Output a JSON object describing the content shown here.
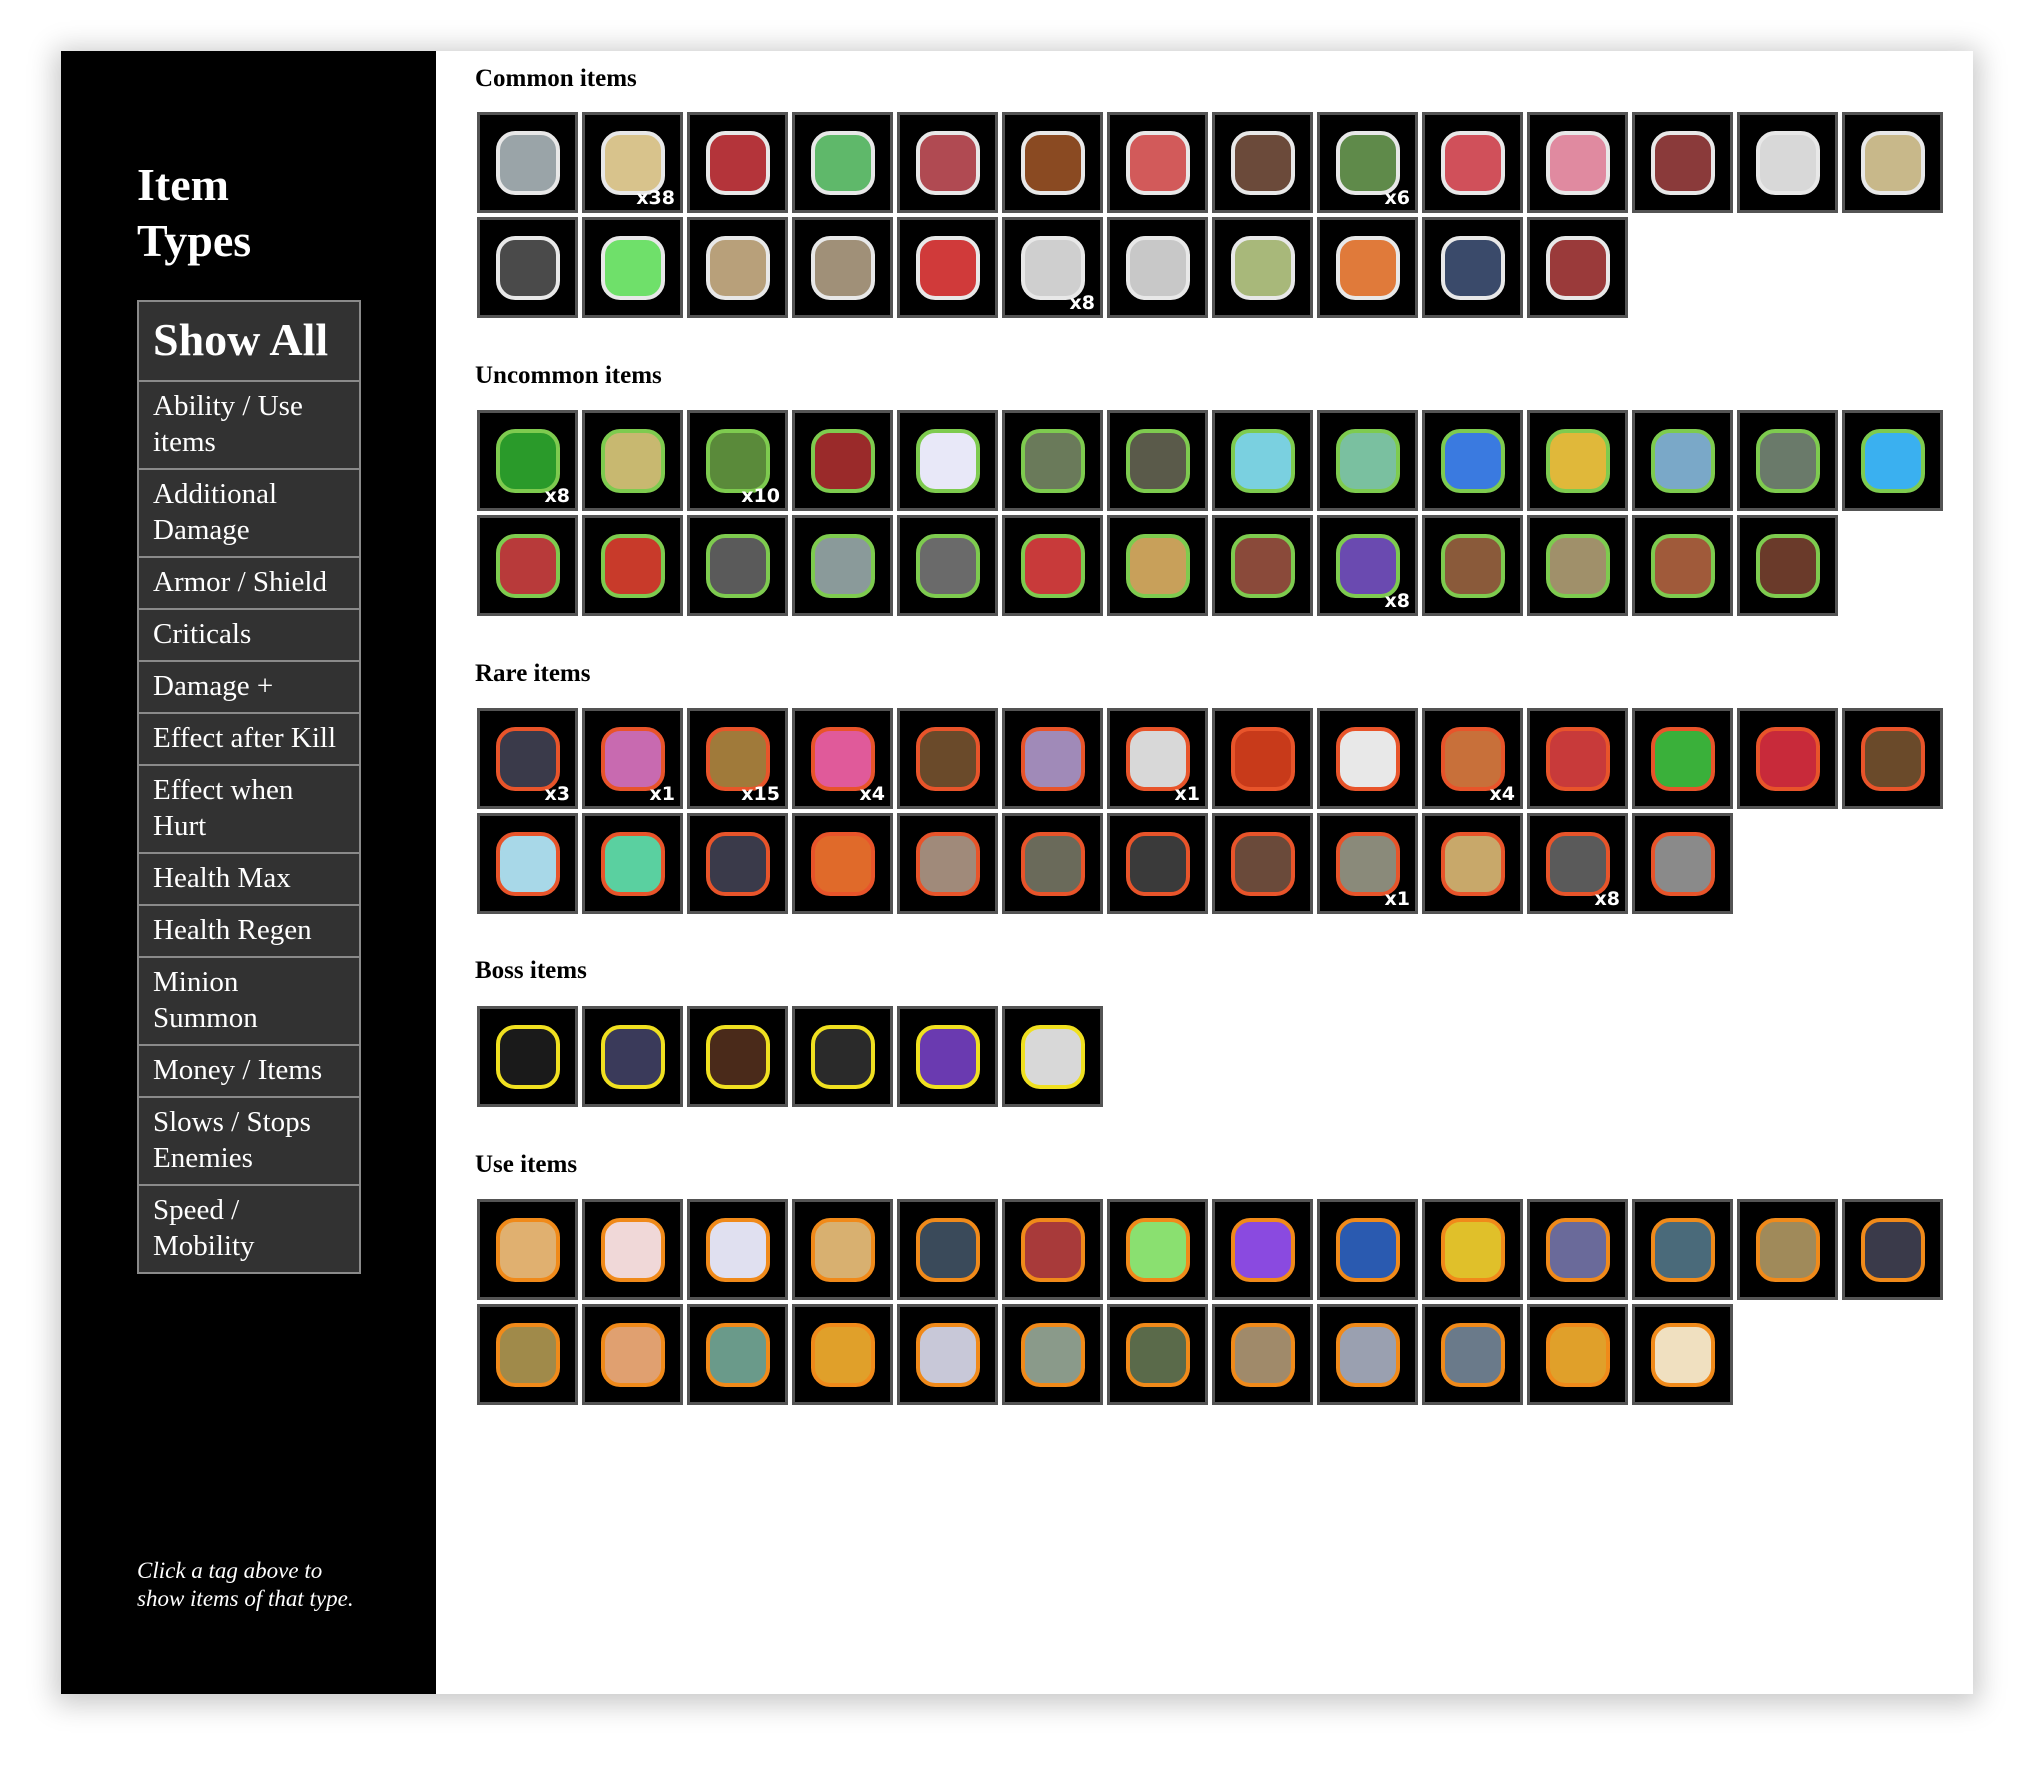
{
  "sidebar": {
    "title": "Item Types",
    "hint": "Click a tag above to show items of that type.",
    "tags": [
      "Show All",
      "Ability / Use items",
      "Additional Damage",
      "Armor / Shield",
      "Criticals",
      "Damage +",
      "Effect after Kill",
      "Effect when Hurt",
      "Health Max",
      "Health Regen",
      "Minion Summon",
      "Money / Items",
      "Slows / Stops Enemies",
      "Speed / Mobility"
    ]
  },
  "colors": {
    "common_outline": "#e8e8e8",
    "uncommon_outline": "#7ecb4f",
    "rare_outline": "#e8542a",
    "boss_outline": "#f0e020",
    "use_outline": "#f08a1a",
    "tile_border": "#545454",
    "tag_background": "#323232"
  },
  "sections": [
    {
      "key": "common",
      "title": "Common items",
      "items": [
        {
          "icon": "thorn-ring-icon",
          "color": "#9aa4a8",
          "count": ""
        },
        {
          "icon": "glove-icon",
          "color": "#d8c38c",
          "count": "x38"
        },
        {
          "icon": "rocket-icon",
          "color": "#b4343a",
          "count": ""
        },
        {
          "icon": "green-bag-icon",
          "color": "#5fb86a",
          "count": ""
        },
        {
          "icon": "cane-icon",
          "color": "#b04a52",
          "count": ""
        },
        {
          "icon": "orb-icon",
          "color": "#8a4a22",
          "count": ""
        },
        {
          "icon": "red-gem-icon",
          "color": "#d25a5a",
          "count": ""
        },
        {
          "icon": "boot-icon",
          "color": "#6b4a3a",
          "count": ""
        },
        {
          "icon": "green-scarf-icon",
          "color": "#5f8a4a",
          "count": "x6"
        },
        {
          "icon": "glasses-icon",
          "color": "#d0505a",
          "count": ""
        },
        {
          "icon": "piggy-bank-icon",
          "color": "#e08aa0",
          "count": ""
        },
        {
          "icon": "meat-icon",
          "color": "#8a3a3a",
          "count": ""
        },
        {
          "icon": "medkit-icon",
          "color": "#d8d8d8",
          "count": ""
        },
        {
          "icon": "tooth-icon",
          "color": "#c8b88a",
          "count": ""
        },
        {
          "icon": "pistol-mount-icon",
          "color": "#4a4a4a",
          "count": ""
        },
        {
          "icon": "potion-icon",
          "color": "#6fe06a",
          "count": ""
        },
        {
          "icon": "bone-icon",
          "color": "#b8a07a",
          "count": ""
        },
        {
          "icon": "knife-icon",
          "color": "#a09078",
          "count": ""
        },
        {
          "icon": "dice-icon",
          "color": "#d03a3a",
          "count": ""
        },
        {
          "icon": "syringe-icon",
          "color": "#cfcfcf",
          "count": "x8"
        },
        {
          "icon": "dna-icon",
          "color": "#c8c8c8",
          "count": ""
        },
        {
          "icon": "egg-icon",
          "color": "#a8b87a",
          "count": ""
        },
        {
          "icon": "magnifier-icon",
          "color": "#e07a3a",
          "count": ""
        },
        {
          "icon": "blaster-icon",
          "color": "#3a4a6a",
          "count": ""
        },
        {
          "icon": "banner-icon",
          "color": "#9a3a3a",
          "count": ""
        }
      ]
    },
    {
      "key": "uncommon",
      "title": "Uncommon items",
      "items": [
        {
          "icon": "clover-icon",
          "color": "#2a9a2a",
          "count": "x8"
        },
        {
          "icon": "lockbox-icon",
          "color": "#c8b870",
          "count": ""
        },
        {
          "icon": "green-sock-icon",
          "color": "#5a8a3a",
          "count": "x10"
        },
        {
          "icon": "boxing-glove-icon",
          "color": "#9a2a2a",
          "count": ""
        },
        {
          "icon": "snowflake-icon",
          "color": "#e8e8f8",
          "count": ""
        },
        {
          "icon": "hand-icon",
          "color": "#6a7a5a",
          "count": ""
        },
        {
          "icon": "leg-icon",
          "color": "#5a5a4a",
          "count": ""
        },
        {
          "icon": "glass-tube-icon",
          "color": "#7ad0e0",
          "count": ""
        },
        {
          "icon": "slime-icon",
          "color": "#7ac0a0",
          "count": ""
        },
        {
          "icon": "crosshair-icon",
          "color": "#3a7ae0",
          "count": ""
        },
        {
          "icon": "gold-gun-icon",
          "color": "#e0b83a",
          "count": ""
        },
        {
          "icon": "sack-icon",
          "color": "#7aa8c8",
          "count": ""
        },
        {
          "icon": "pickaxe-icon",
          "color": "#6a7a6a",
          "count": ""
        },
        {
          "icon": "feather-icon",
          "color": "#3ab0f0",
          "count": ""
        },
        {
          "icon": "dynamite-icon",
          "color": "#b83a3a",
          "count": ""
        },
        {
          "icon": "ruby-icon",
          "color": "#c83a2a",
          "count": ""
        },
        {
          "icon": "pot-icon",
          "color": "#5a5a5a",
          "count": ""
        },
        {
          "icon": "wolf-head-icon",
          "color": "#8a9a9a",
          "count": ""
        },
        {
          "icon": "handcuffs-icon",
          "color": "#6a6a6a",
          "count": ""
        },
        {
          "icon": "whip-icon",
          "color": "#c83a3a",
          "count": ""
        },
        {
          "icon": "jetpack-icon",
          "color": "#c8a05a",
          "count": ""
        },
        {
          "icon": "rock-icon",
          "color": "#8a4a3a",
          "count": ""
        },
        {
          "icon": "hourglass-icon",
          "color": "#6a4ab0",
          "count": "x8"
        },
        {
          "icon": "teddy-bear-icon",
          "color": "#8a5a3a",
          "count": ""
        },
        {
          "icon": "rope-icon",
          "color": "#a0906a",
          "count": ""
        },
        {
          "icon": "guitar-icon",
          "color": "#a05a3a",
          "count": ""
        },
        {
          "icon": "jar-icon",
          "color": "#6a3a2a",
          "count": ""
        }
      ]
    },
    {
      "key": "rare",
      "title": "Rare items",
      "items": [
        {
          "icon": "poison-flask-icon",
          "color": "#3a3a4a",
          "count": "x3"
        },
        {
          "icon": "purple-dagger-icon",
          "color": "#c86ab0",
          "count": "x1"
        },
        {
          "icon": "brown-boot-icon",
          "color": "#a07a3a",
          "count": "x15"
        },
        {
          "icon": "pink-orb-icon",
          "color": "#e05a9a",
          "count": "x4"
        },
        {
          "icon": "rifle-icon",
          "color": "#6a4a2a",
          "count": ""
        },
        {
          "icon": "scroll-blade-icon",
          "color": "#a08ab8",
          "count": ""
        },
        {
          "icon": "ghost-bear-icon",
          "color": "#d8d8d8",
          "count": "x1"
        },
        {
          "icon": "fire-fist-icon",
          "color": "#c83a1a",
          "count": ""
        },
        {
          "icon": "theater-mask-icon",
          "color": "#e8e8e8",
          "count": ""
        },
        {
          "icon": "harp-icon",
          "color": "#c8703a",
          "count": "x4"
        },
        {
          "icon": "stapler-icon",
          "color": "#c83a3a",
          "count": ""
        },
        {
          "icon": "green-egg-icon",
          "color": "#3ab03a",
          "count": ""
        },
        {
          "icon": "laser-tube-icon",
          "color": "#c82a3a",
          "count": ""
        },
        {
          "icon": "brown-box-icon",
          "color": "#6a4a2a",
          "count": ""
        },
        {
          "icon": "ice-cube-icon",
          "color": "#a8d8e8",
          "count": ""
        },
        {
          "icon": "thrusters-icon",
          "color": "#5ad0a0",
          "count": ""
        },
        {
          "icon": "ray-gun-icon",
          "color": "#3a3a4a",
          "count": ""
        },
        {
          "icon": "orange-orb-icon",
          "color": "#e06a2a",
          "count": ""
        },
        {
          "icon": "armor-icon",
          "color": "#a08a7a",
          "count": ""
        },
        {
          "icon": "hammer-icon",
          "color": "#6a6a5a",
          "count": ""
        },
        {
          "icon": "telescope-icon",
          "color": "#3a3a3a",
          "count": ""
        },
        {
          "icon": "mushroom-icon",
          "color": "#6a4a3a",
          "count": ""
        },
        {
          "icon": "log-icon",
          "color": "#8a8a7a",
          "count": "x1"
        },
        {
          "icon": "map-icon",
          "color": "#c8a86a",
          "count": ""
        },
        {
          "icon": "axe-icon",
          "color": "#5a5a5a",
          "count": "x8"
        },
        {
          "icon": "skull-icon",
          "color": "#8a8a8a",
          "count": ""
        }
      ]
    },
    {
      "key": "boss",
      "title": "Boss items",
      "items": [
        {
          "icon": "eye-orb-icon",
          "color": "#1a1a1a",
          "count": ""
        },
        {
          "icon": "dark-rock-icon",
          "color": "#3a3a5a",
          "count": ""
        },
        {
          "icon": "tentacle-icon",
          "color": "#4a2a1a",
          "count": ""
        },
        {
          "icon": "horseshoe-icon",
          "color": "#2a2a2a",
          "count": ""
        },
        {
          "icon": "crystal-shard-icon",
          "color": "#6a3ab0",
          "count": ""
        },
        {
          "icon": "moon-icon",
          "color": "#d8d8d8",
          "count": ""
        }
      ]
    },
    {
      "key": "use",
      "title": "Use items",
      "items": [
        {
          "icon": "ship-wheel-icon",
          "color": "#e0b070",
          "count": ""
        },
        {
          "icon": "pillow-icon",
          "color": "#f0d8d8",
          "count": ""
        },
        {
          "icon": "smiley-icon",
          "color": "#e0e0f0",
          "count": ""
        },
        {
          "icon": "cheese-icon",
          "color": "#d8b070",
          "count": ""
        },
        {
          "icon": "toolbox-icon",
          "color": "#3a4a5a",
          "count": ""
        },
        {
          "icon": "detonator-icon",
          "color": "#a83a3a",
          "count": ""
        },
        {
          "icon": "apple-icon",
          "color": "#8ae070",
          "count": ""
        },
        {
          "icon": "amethyst-icon",
          "color": "#8a4ae0",
          "count": ""
        },
        {
          "icon": "blue-globe-icon",
          "color": "#2a5ab0",
          "count": ""
        },
        {
          "icon": "gold-bomb-icon",
          "color": "#e0c02a",
          "count": ""
        },
        {
          "icon": "dots-pad-icon",
          "color": "#6a6a9a",
          "count": ""
        },
        {
          "icon": "canister-icon",
          "color": "#4a6a7a",
          "count": ""
        },
        {
          "icon": "monkey-icon",
          "color": "#a08a5a",
          "count": ""
        },
        {
          "icon": "fish-icon",
          "color": "#3a3a4a",
          "count": ""
        },
        {
          "icon": "money-bag-icon",
          "color": "#a08a4a",
          "count": ""
        },
        {
          "icon": "bandage-icon",
          "color": "#e0a070",
          "count": ""
        },
        {
          "icon": "brain-jar-icon",
          "color": "#6a9a8a",
          "count": ""
        },
        {
          "icon": "lantern-icon",
          "color": "#e0a02a",
          "count": ""
        },
        {
          "icon": "sawblade-icon",
          "color": "#c8c8d8",
          "count": ""
        },
        {
          "icon": "mirror-icon",
          "color": "#8a9a8a",
          "count": ""
        },
        {
          "icon": "grenade-icon",
          "color": "#5a6a4a",
          "count": ""
        },
        {
          "icon": "key-icon",
          "color": "#a08a6a",
          "count": ""
        },
        {
          "icon": "crystal-ball-icon",
          "color": "#9aa0b0",
          "count": ""
        },
        {
          "icon": "phone-icon",
          "color": "#6a7a8a",
          "count": ""
        },
        {
          "icon": "golden-skull-icon",
          "color": "#e0a02a",
          "count": ""
        },
        {
          "icon": "pocket-watch-icon",
          "color": "#f0e0c0",
          "count": ""
        }
      ]
    }
  ]
}
